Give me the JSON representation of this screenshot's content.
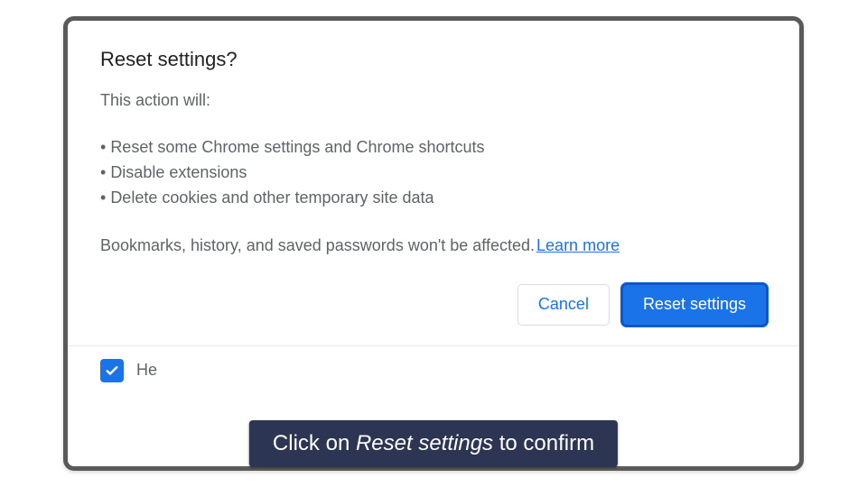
{
  "dialog": {
    "title": "Reset settings?",
    "intro": "This action will:",
    "bullets": [
      "Reset some Chrome settings and Chrome shortcuts",
      "Disable extensions",
      "Delete cookies and other temporary site data"
    ],
    "footnote": "Bookmarks, history, and saved passwords won't be affected.",
    "learn_more": "Learn more",
    "cancel": "Cancel",
    "confirm": "Reset settings",
    "footer_checkbox_label": "He"
  },
  "caption": {
    "pre": "Click on ",
    "em": "Reset settings",
    "post": " to confirm"
  }
}
